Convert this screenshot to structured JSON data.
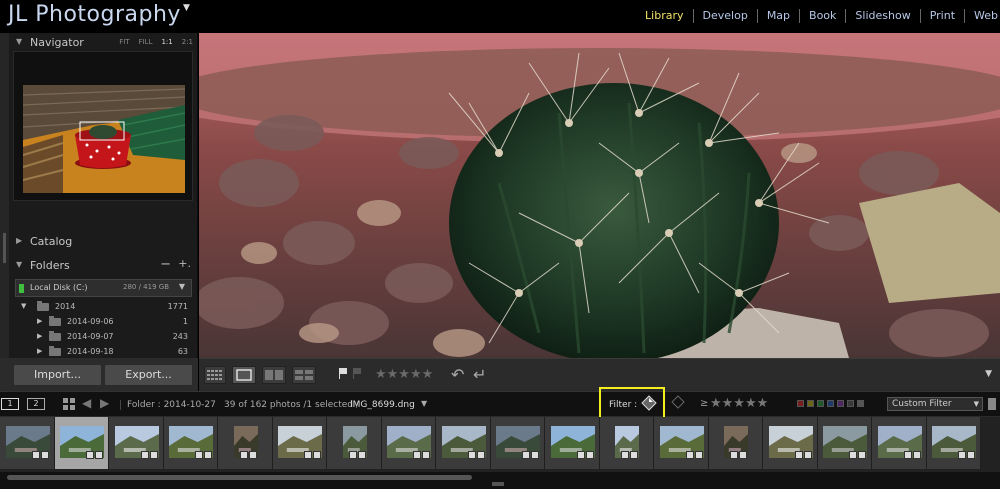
{
  "app": {
    "brand": "JL Photography",
    "modules": [
      "Library",
      "Develop",
      "Map",
      "Book",
      "Slideshow",
      "Print",
      "Web"
    ],
    "active_module": "Library"
  },
  "left_panel": {
    "navigator": {
      "title": "Navigator",
      "zoom_options": [
        "FIT",
        "FILL",
        "1:1",
        "2:1"
      ],
      "active_zoom": "1:1"
    },
    "catalog": {
      "title": "Catalog"
    },
    "folders": {
      "title": "Folders",
      "minus": "−",
      "plus": "+.",
      "volume": {
        "name": "Local Disk (C:)",
        "space": "280 / 419 GB"
      },
      "items": [
        {
          "name": "2014",
          "count": "1771"
        },
        {
          "name": "2014-09-06",
          "count": "1"
        },
        {
          "name": "2014-09-07",
          "count": "243"
        },
        {
          "name": "2014-09-18",
          "count": "63"
        }
      ]
    },
    "buttons": {
      "import": "Import...",
      "export": "Export..."
    }
  },
  "filmstrip_bar": {
    "page1": "1",
    "page2": "2",
    "folder": "Folder : 2014-10-27",
    "count": "39 of 162 photos /1 selected /",
    "filename": "IMG_8699.dng",
    "filter_label": "Filter :",
    "rating_op": "≥",
    "custom_filter": "Custom Filter"
  },
  "toolbar": {
    "stars": "★★★★★",
    "rating_stars": "★★★★★"
  },
  "colors": {
    "active_module": "#f2e26b",
    "module": "#b7c7e8",
    "highlight": "#f5ee1f",
    "label_colors": [
      "#c0392b",
      "#d4c218",
      "#2ea84a",
      "#3a6cc7",
      "#8e44ad",
      "#666666",
      "#888888"
    ]
  },
  "filmstrip": {
    "thumbnails": [
      "family-portrait",
      "mountain-ruins",
      "cloudy-mountains",
      "valley-ruins",
      "couple-selfie",
      "hillside-panorama",
      "child-ruins",
      "mountain-ruins-2",
      "machu-picchu",
      "peak-ruins",
      "terraces",
      "couple-2",
      "machu-picchu-2",
      "couple-3",
      "ruins-wide",
      "ruins-wide-2",
      "ruins-wide-3",
      "ruins-wide-4"
    ],
    "selected_index": 1
  }
}
